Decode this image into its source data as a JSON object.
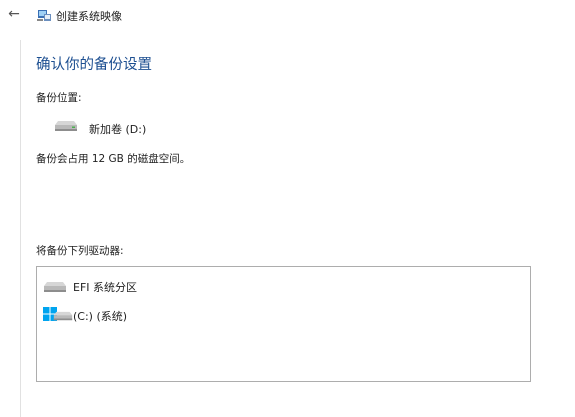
{
  "window": {
    "title": "创建系统映像"
  },
  "main": {
    "heading": "确认你的备份设置",
    "backup_location_label": "备份位置:",
    "backup_target_drive": "新加卷 (D:)",
    "space_usage_text": "备份会占用 12 GB 的磁盘空间。",
    "drives_list_label": "将备份下列驱动器:",
    "drives": [
      {
        "label": "EFI 系统分区",
        "icon": "drive-icon"
      },
      {
        "label": "(C:) (系统)",
        "icon": "windows-drive-icon"
      }
    ]
  },
  "colors": {
    "heading": "#1d4f91",
    "windows_logo": "#00a4ef"
  }
}
